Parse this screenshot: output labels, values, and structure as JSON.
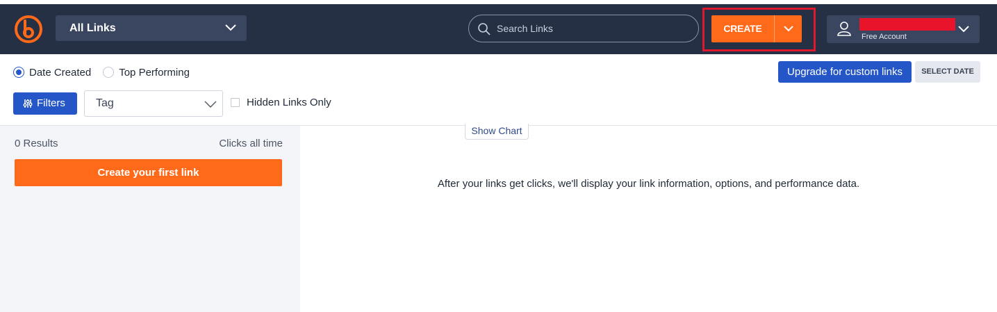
{
  "header": {
    "link_selector": "All Links",
    "search_placeholder": "Search Links",
    "create_label": "CREATE",
    "account_plan": "Free Account"
  },
  "sort": {
    "options": [
      {
        "label": "Date Created",
        "selected": true
      },
      {
        "label": "Top Performing",
        "selected": false
      }
    ]
  },
  "actions": {
    "upgrade_label": "Upgrade for custom links",
    "select_date_label": "SELECT DATE"
  },
  "filters": {
    "filters_label": "Filters",
    "tag_label": "Tag",
    "hidden_label": "Hidden Links Only"
  },
  "sidebar": {
    "results": "0 Results",
    "clicks_label": "Clicks all time",
    "create_first_label": "Create your first link"
  },
  "main": {
    "show_chart_label": "Show Chart",
    "empty_message": "After your links get clicks, we'll display your link information, options, and performance data."
  },
  "colors": {
    "header_bg": "#263045",
    "accent_orange": "#ff6a1a",
    "accent_blue": "#2456c8",
    "highlight_red": "#e0182d"
  }
}
